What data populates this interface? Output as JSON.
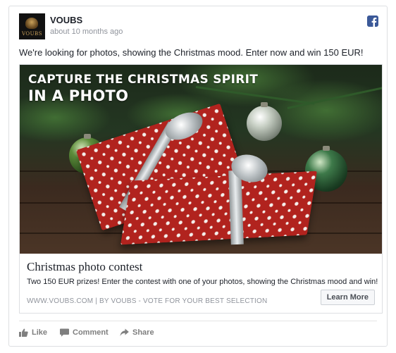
{
  "post": {
    "page_name": "VOUBS",
    "time": "about 10 months ago",
    "text": "We're looking for photos, showing the Christmas mood. Enter now and win 150 EUR!",
    "avatar_text": "VOUBS"
  },
  "link": {
    "image_title_line1": "CAPTURE THE CHRISTMAS SPIRIT",
    "image_title_line2": "IN A PHOTO",
    "title": "Christmas photo contest",
    "description": "Two 150 EUR prizes! Enter the contest with one of your photos, showing the Christmas mood and win!",
    "domain": "WWW.VOUBS.COM | BY VOUBS - VOTE FOR YOUR BEST SELECTION",
    "cta_label": "Learn More"
  },
  "actions": {
    "like": "Like",
    "comment": "Comment",
    "share": "Share"
  },
  "icons": {
    "facebook": "facebook-icon",
    "like": "thumbs-up-icon",
    "comment": "speech-bubble-icon",
    "share": "share-arrow-icon"
  },
  "colors": {
    "facebook_blue": "#3b5998",
    "text": "#1d2129",
    "muted": "#90949c"
  }
}
